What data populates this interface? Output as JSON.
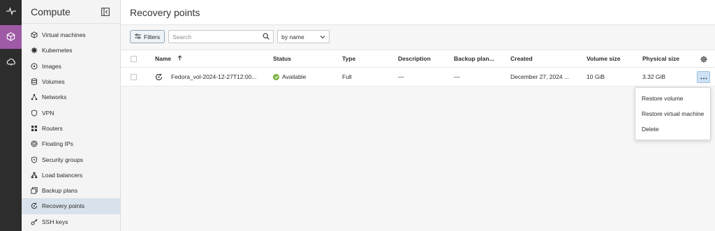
{
  "rail": {
    "items": [
      {
        "icon": "activity-icon"
      },
      {
        "icon": "cube-icon",
        "active": true
      },
      {
        "icon": "cloud-icon"
      }
    ]
  },
  "sidebar": {
    "title": "Compute",
    "items": [
      {
        "label": "Virtual machines",
        "icon": "cube-outline-icon"
      },
      {
        "label": "Kubernetes",
        "icon": "kubernetes-icon"
      },
      {
        "label": "Images",
        "icon": "disc-icon"
      },
      {
        "label": "Volumes",
        "icon": "database-icon"
      },
      {
        "label": "Networks",
        "icon": "network-icon"
      },
      {
        "label": "VPN",
        "icon": "shield-icon"
      },
      {
        "label": "Routers",
        "icon": "router-icon"
      },
      {
        "label": "Floating IPs",
        "icon": "floating-ip-icon"
      },
      {
        "label": "Security groups",
        "icon": "security-icon"
      },
      {
        "label": "Load balancers",
        "icon": "load-balancer-icon"
      },
      {
        "label": "Backup plans",
        "icon": "backup-icon"
      },
      {
        "label": "Recovery points",
        "icon": "recovery-icon",
        "active": true
      },
      {
        "label": "SSH keys",
        "icon": "key-icon"
      }
    ]
  },
  "page": {
    "title": "Recovery points"
  },
  "toolbar": {
    "filters_label": "Filters",
    "search_placeholder": "Search",
    "sort_value": "by name"
  },
  "table": {
    "columns": [
      "Name",
      "Status",
      "Type",
      "Description",
      "Backup plan...",
      "Created",
      "Volume size",
      "Physical size"
    ],
    "rows": [
      {
        "name": "Fedora_vol-2024-12-27T12:00...",
        "status": "Available",
        "type": "Full",
        "description": "—",
        "backup_plan": "—",
        "created": "December 27, 2024 ...",
        "volume_size": "10 GiB",
        "physical_size": "3.32 GiB"
      }
    ]
  },
  "context_menu": {
    "items": [
      "Restore volume",
      "Restore virtual machine",
      "Delete"
    ]
  },
  "colors": {
    "accent": "#9f5aa6",
    "status_ok": "#7cb342",
    "sidebar_active": "#d8e2ec"
  }
}
